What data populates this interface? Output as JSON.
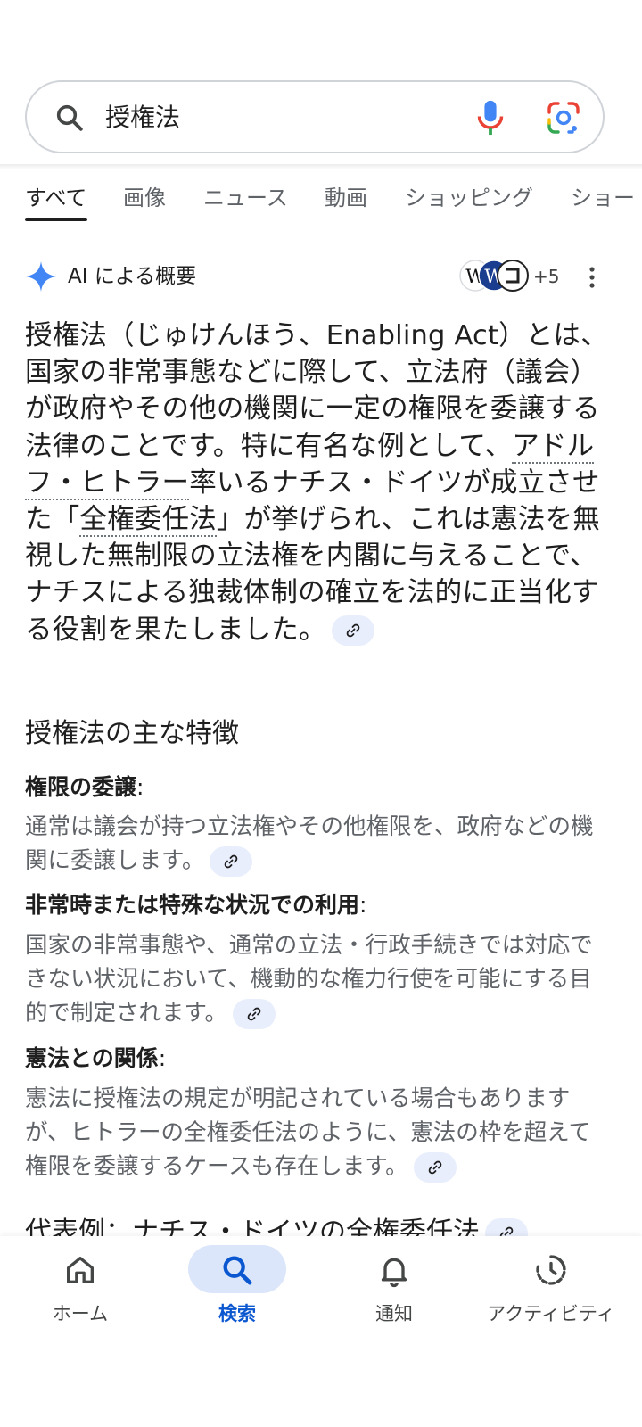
{
  "search": {
    "query": "授権法"
  },
  "tabs": [
    {
      "label": "すべて",
      "active": true
    },
    {
      "label": "画像"
    },
    {
      "label": "ニュース"
    },
    {
      "label": "動画"
    },
    {
      "label": "ショッピング"
    },
    {
      "label": "ショー"
    }
  ],
  "ai_overview": {
    "title": "AI による概要",
    "sources_more": "+5",
    "paragraph": {
      "part1": "授権法（じゅけんほう、Enabling Act）とは、国家の非常事態などに際して、立法府（議会）が政府やその他の機関に一定の権限を委譲する法律のことです。特に有名な例として、",
      "link1": "アドルフ・ヒトラー",
      "part2": "率いるナチス・ドイツが成立させた「",
      "link2": "全権委任法",
      "part3": "」が挙げられ、これは憲法を無視した無制限の立法権を内閣に与えることで、ナチスによる独裁体制の確立を法的に正当化する役割を果たしました。"
    },
    "section_heading": "授権法の主な特徴",
    "features": [
      {
        "title": "権限の委譲",
        "body": "通常は議会が持つ立法権やその他権限を、政府などの機関に委譲します。"
      },
      {
        "title": "非常時または特殊な状況での利用",
        "body": "国家の非常事態や、通常の立法・行政手続きでは対応できない状況において、機動的な権力行使を可能にする目的で制定されます。"
      },
      {
        "title": "憲法との関係",
        "body": "憲法に授権法の規定が明記されている場合もありますが、ヒトラーの全権委任法のように、憲法の枠を超えて権限を委譲するケースも存在します。"
      }
    ],
    "next_heading": "代表例：ナチス・ドイツの全権委任法"
  },
  "bottom_nav": [
    {
      "label": "ホーム",
      "icon": "home-icon"
    },
    {
      "label": "検索",
      "icon": "search-icon",
      "active": true
    },
    {
      "label": "通知",
      "icon": "bell-icon"
    },
    {
      "label": "アクティビティ",
      "icon": "activity-icon"
    }
  ],
  "colors": {
    "accent": "#0b57d0",
    "active_pill": "#dce6fb",
    "link_chip": "#e8eefc",
    "muted_text": "#5f6368"
  }
}
